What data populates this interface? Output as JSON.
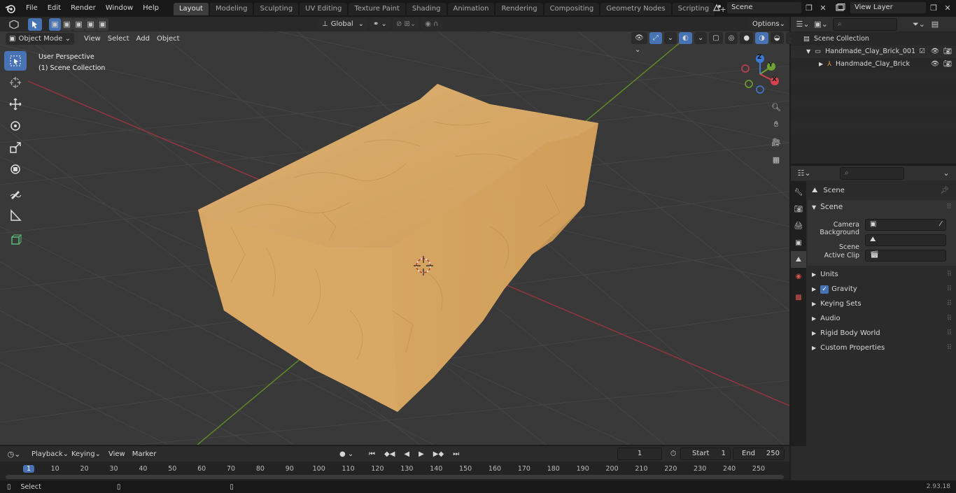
{
  "menu": {
    "items": [
      "File",
      "Edit",
      "Render",
      "Window",
      "Help"
    ]
  },
  "workspaces": [
    "Layout",
    "Modeling",
    "Sculpting",
    "UV Editing",
    "Texture Paint",
    "Shading",
    "Animation",
    "Rendering",
    "Compositing",
    "Geometry Nodes",
    "Scripting"
  ],
  "active_workspace": "Layout",
  "scene_field": "Scene",
  "view_layer_field": "View Layer",
  "viewport": {
    "transform_orientation": "Global",
    "options_label": "Options",
    "mode": "Object Mode",
    "header_menus": [
      "View",
      "Select",
      "Add",
      "Object"
    ],
    "overlay_title": "User Perspective",
    "overlay_subtitle": "(1) Scene Collection"
  },
  "gizmo": {
    "x": "X",
    "y": "Y",
    "z": "Z"
  },
  "outliner": {
    "root": "Scene Collection",
    "items": [
      {
        "label": "Handmade_Clay_Brick_001",
        "type": "collection"
      },
      {
        "label": "Handmade_Clay_Brick",
        "type": "object"
      }
    ]
  },
  "properties": {
    "context_title": "Scene",
    "section_title": "Scene",
    "fields": [
      {
        "label": "Camera",
        "value": ""
      },
      {
        "label": "Background Scene",
        "value": ""
      },
      {
        "label": "Active Clip",
        "value": ""
      }
    ],
    "subpanels": [
      "Units",
      "Gravity",
      "Keying Sets",
      "Audio",
      "Rigid Body World",
      "Custom Properties"
    ],
    "gravity_checked": true
  },
  "timeline": {
    "menus": [
      "Playback",
      "Keying",
      "View",
      "Marker"
    ],
    "current_frame": "1",
    "start_label": "Start",
    "start_value": "1",
    "end_label": "End",
    "end_value": "250",
    "ruler": [
      "1",
      "10",
      "20",
      "30",
      "40",
      "50",
      "60",
      "70",
      "80",
      "90",
      "100",
      "110",
      "120",
      "130",
      "140",
      "150",
      "160",
      "170",
      "180",
      "190",
      "200",
      "210",
      "220",
      "230",
      "240",
      "250"
    ]
  },
  "status": {
    "left": "Select",
    "version": "2.93.18"
  },
  "colors": {
    "accent": "#4772b3",
    "brick": "#d7a866",
    "axis_x": "#b03a48",
    "axis_y": "#6a9a2a"
  }
}
